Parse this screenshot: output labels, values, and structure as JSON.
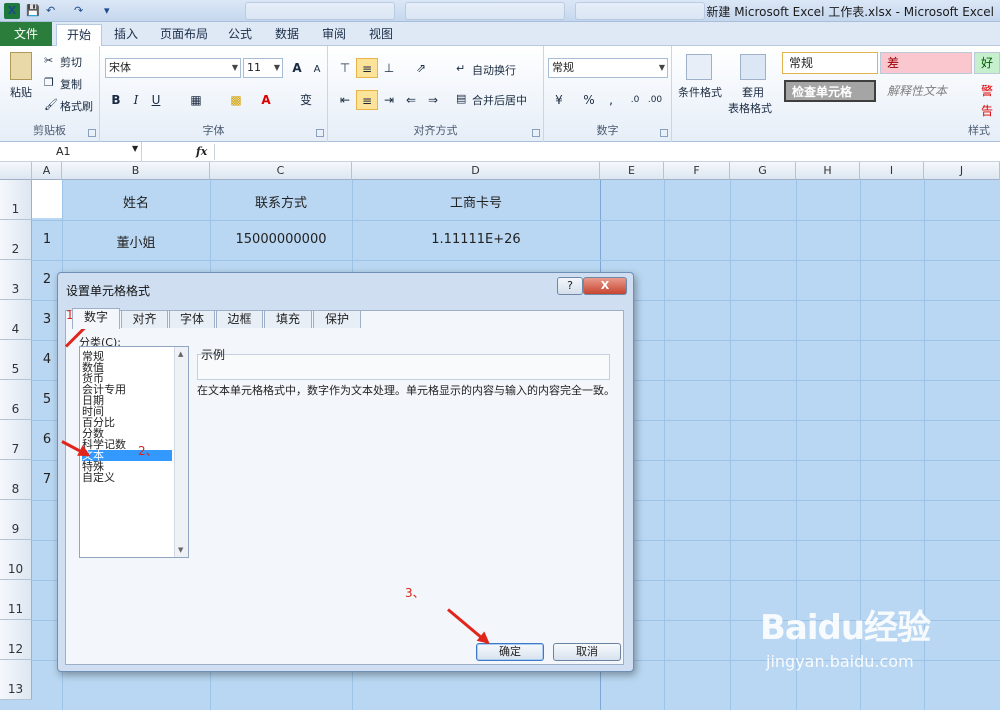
{
  "window": {
    "title": "新建 Microsoft Excel 工作表.xlsx - Microsoft Excel",
    "icon": "excel-icon"
  },
  "quick_access": [
    "save-icon",
    "undo-icon",
    "redo-icon",
    "customize-icon"
  ],
  "ribbon_tabs": [
    "文件",
    "开始",
    "插入",
    "页面布局",
    "公式",
    "数据",
    "审阅",
    "视图"
  ],
  "ribbon": {
    "clipboard": {
      "paste": "粘贴",
      "cut": "剪切",
      "copy": "复制",
      "format_painter": "格式刷",
      "label": "剪贴板"
    },
    "font": {
      "family": "宋体",
      "size": "11",
      "label": "字体",
      "bold": "B",
      "italic": "I",
      "underline": "U",
      "grow": "A",
      "shrink": "A",
      "phonetic": "变"
    },
    "alignment": {
      "wrap": "自动换行",
      "merge": "合并后居中",
      "label": "对齐方式"
    },
    "number": {
      "format": "常规",
      "percent": "%",
      "comma": ",",
      "label": "数字"
    },
    "styles": {
      "conditional": "条件格式",
      "table1": "套用",
      "table2": "表格格式",
      "normal": "常规",
      "bad": "差",
      "good": "好",
      "check_cell": "检查单元格",
      "explanatory": "解释性文本",
      "warning": "警告",
      "label": "样式"
    }
  },
  "formula_bar": {
    "name_box": "A1",
    "fx": "fx",
    "value": ""
  },
  "grid": {
    "columns": [
      "A",
      "B",
      "C",
      "D",
      "E",
      "F",
      "G",
      "H",
      "I",
      "J"
    ],
    "rows": [
      "1",
      "2",
      "3",
      "4",
      "5",
      "6",
      "7",
      "8",
      "9",
      "10",
      "11",
      "12",
      "13"
    ],
    "header_row": [
      "姓名",
      "联系方式",
      "工商卡号"
    ],
    "data_rows": [
      {
        "index": "1",
        "name": "董小姐",
        "phone": "15000000000",
        "card": "1.11111E+26"
      },
      {
        "index": "2",
        "name": "",
        "phone": "",
        "card": ""
      },
      {
        "index": "3",
        "name": "",
        "phone": "",
        "card": ""
      },
      {
        "index": "4",
        "name": "",
        "phone": "",
        "card": ""
      },
      {
        "index": "5",
        "name": "",
        "phone": "",
        "card": ""
      },
      {
        "index": "6",
        "name": "",
        "phone": "",
        "card": ""
      },
      {
        "index": "7",
        "name": "",
        "phone": "",
        "card": ""
      }
    ]
  },
  "dialog": {
    "title": "设置单元格格式",
    "help": "?",
    "close": "X",
    "tabs": [
      "数字",
      "对齐",
      "字体",
      "边框",
      "填充",
      "保护"
    ],
    "active_tab": "数字",
    "category_label": "分类(C):",
    "categories": [
      "常规",
      "数值",
      "货币",
      "会计专用",
      "日期",
      "时间",
      "百分比",
      "分数",
      "科学记数",
      "文本",
      "特殊",
      "自定义"
    ],
    "selected_category": "文本",
    "sample_label": "示例",
    "description": "在文本单元格格式中，数字作为文本处理。单元格显示的内容与输入的内容完全一致。",
    "ok": "确定",
    "cancel": "取消"
  },
  "annotations": {
    "step1": "1、",
    "step2": "2、",
    "step3": "3、",
    "color": "#e0261c"
  },
  "watermark": {
    "brand": "Baidu经验",
    "site": "jingyan.baidu.com"
  }
}
